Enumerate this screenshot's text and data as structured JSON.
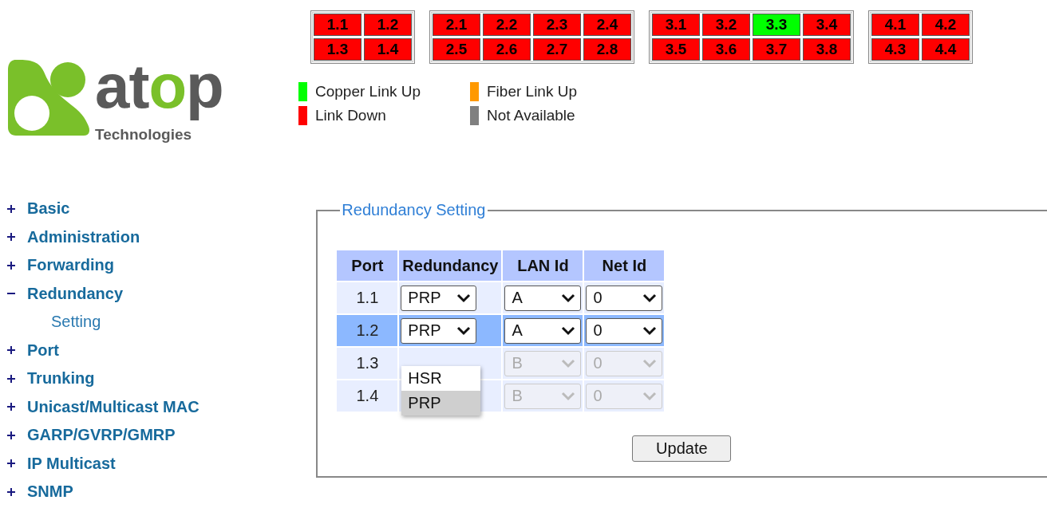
{
  "logo": {
    "name": "atop",
    "tagline": "Technologies"
  },
  "port_groups": [
    {
      "ports": [
        {
          "label": "1.1",
          "color": "#ff0000"
        },
        {
          "label": "1.2",
          "color": "#ff0000"
        },
        {
          "label": "1.3",
          "color": "#ff0000"
        },
        {
          "label": "1.4",
          "color": "#ff0000"
        }
      ]
    },
    {
      "ports": [
        {
          "label": "2.1",
          "color": "#ff0000"
        },
        {
          "label": "2.2",
          "color": "#ff0000"
        },
        {
          "label": "2.3",
          "color": "#ff0000"
        },
        {
          "label": "2.4",
          "color": "#ff0000"
        },
        {
          "label": "2.5",
          "color": "#ff0000"
        },
        {
          "label": "2.6",
          "color": "#ff0000"
        },
        {
          "label": "2.7",
          "color": "#ff0000"
        },
        {
          "label": "2.8",
          "color": "#ff0000"
        }
      ]
    },
    {
      "ports": [
        {
          "label": "3.1",
          "color": "#ff0000"
        },
        {
          "label": "3.2",
          "color": "#ff0000"
        },
        {
          "label": "3.3",
          "color": "#00ff00"
        },
        {
          "label": "3.4",
          "color": "#ff0000"
        },
        {
          "label": "3.5",
          "color": "#ff0000"
        },
        {
          "label": "3.6",
          "color": "#ff0000"
        },
        {
          "label": "3.7",
          "color": "#ff0000"
        },
        {
          "label": "3.8",
          "color": "#ff0000"
        }
      ]
    },
    {
      "ports": [
        {
          "label": "4.1",
          "color": "#ff0000"
        },
        {
          "label": "4.2",
          "color": "#ff0000"
        },
        {
          "label": "4.3",
          "color": "#ff0000"
        },
        {
          "label": "4.4",
          "color": "#ff0000"
        }
      ]
    }
  ],
  "legend": [
    {
      "label": "Copper Link Up",
      "color": "#00ff00"
    },
    {
      "label": "Fiber Link Up",
      "color": "#ff9900"
    },
    {
      "label": "Link Down",
      "color": "#ff0000"
    },
    {
      "label": "Not Available",
      "color": "#808080"
    }
  ],
  "sidebar": {
    "items": [
      {
        "label": "Basic",
        "expanded": false
      },
      {
        "label": "Administration",
        "expanded": false
      },
      {
        "label": "Forwarding",
        "expanded": false
      },
      {
        "label": "Redundancy",
        "expanded": true,
        "children": [
          {
            "label": "Setting"
          }
        ]
      },
      {
        "label": "Port",
        "expanded": false
      },
      {
        "label": "Trunking",
        "expanded": false
      },
      {
        "label": "Unicast/Multicast MAC",
        "expanded": false
      },
      {
        "label": "GARP/GVRP/GMRP",
        "expanded": false
      },
      {
        "label": "IP Multicast",
        "expanded": false
      },
      {
        "label": "SNMP",
        "expanded": false
      }
    ]
  },
  "panel": {
    "title": "Redundancy Setting",
    "table": {
      "columns": [
        "Port",
        "Redundancy",
        "LAN Id",
        "Net Id"
      ],
      "rows": [
        {
          "port": "1.1",
          "redundancy": "PRP",
          "lan_id": "A",
          "net_id": "0",
          "selected": false,
          "disabled": false
        },
        {
          "port": "1.2",
          "redundancy": "PRP",
          "lan_id": "A",
          "net_id": "0",
          "selected": true,
          "disabled": false
        },
        {
          "port": "1.3",
          "lan_id": "B",
          "net_id": "0",
          "selected": false,
          "disabled": true
        },
        {
          "port": "1.4",
          "lan_id": "B",
          "net_id": "0",
          "selected": false,
          "disabled": true
        }
      ]
    },
    "dropdown": {
      "options": [
        {
          "label": "HSR",
          "selected": false
        },
        {
          "label": "PRP",
          "selected": true
        }
      ]
    },
    "button": "Update"
  }
}
